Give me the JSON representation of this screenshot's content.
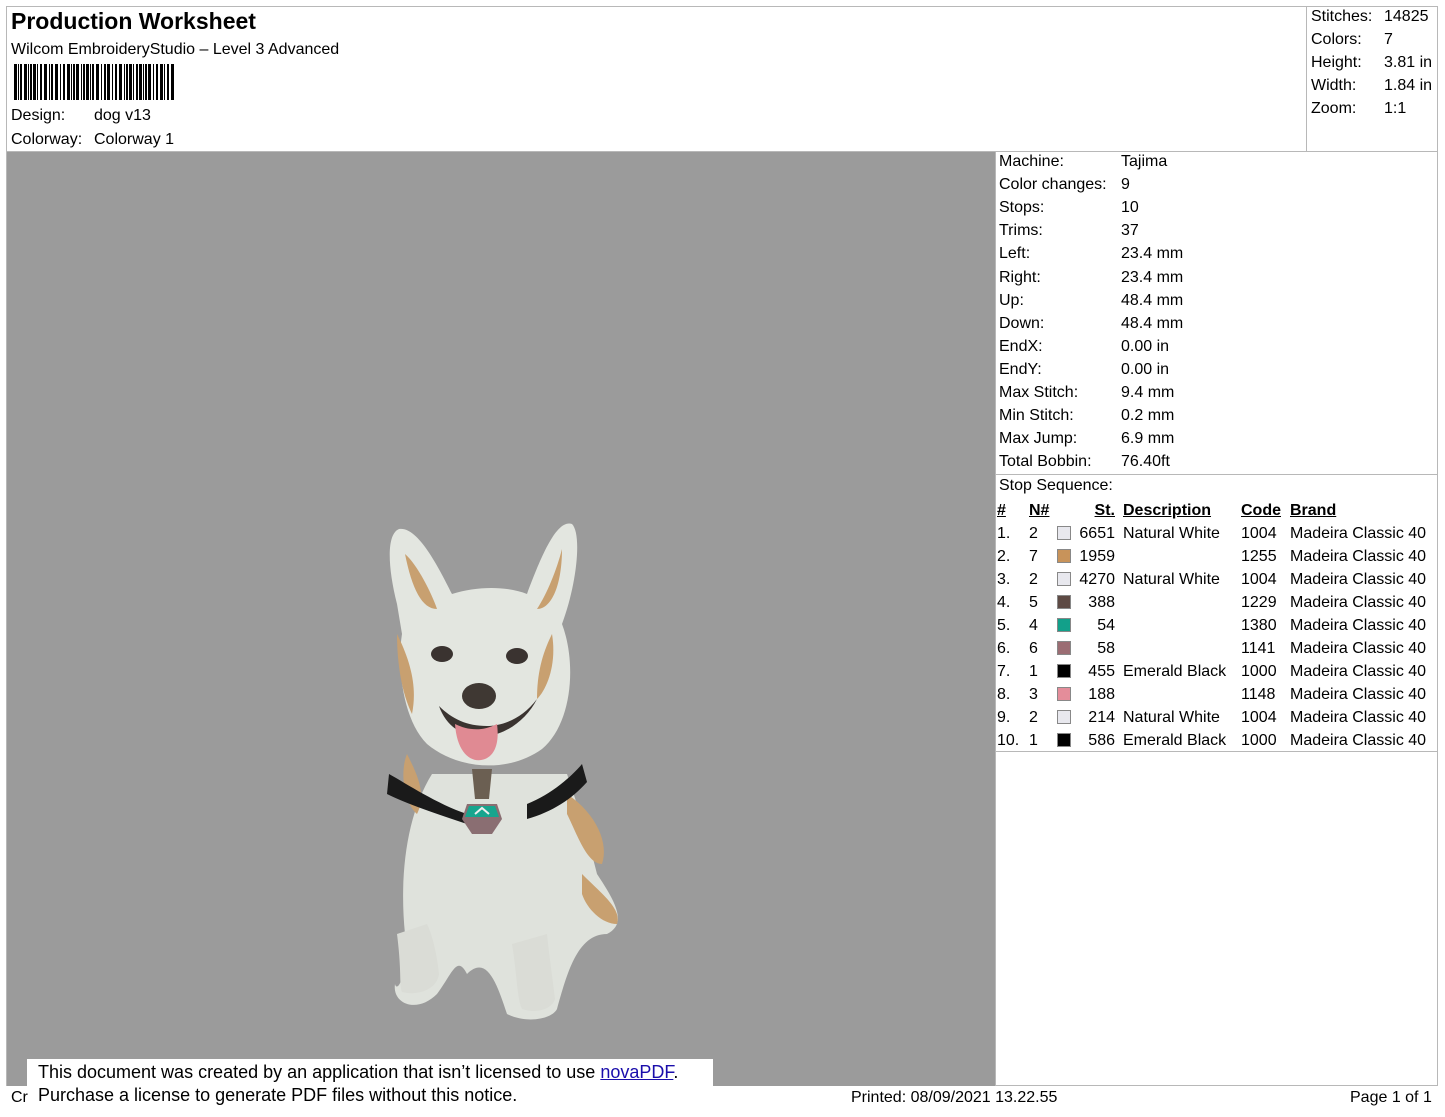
{
  "header": {
    "title": "Production Worksheet",
    "subtitle": "Wilcom EmbroideryStudio – Level 3 Advanced",
    "design_label": "Design:",
    "design_value": "dog v13",
    "colorway_label": "Colorway:",
    "colorway_value": "Colorway 1"
  },
  "summary": [
    {
      "label": "Stitches:",
      "value": "14825"
    },
    {
      "label": "Colors:",
      "value": "7"
    },
    {
      "label": "Height:",
      "value": "3.81 in"
    },
    {
      "label": "Width:",
      "value": "1.84 in"
    },
    {
      "label": "Zoom:",
      "value": "1:1"
    }
  ],
  "machine_info": [
    {
      "label": "Machine:",
      "value": "Tajima"
    },
    {
      "label": "Color changes:",
      "value": "9"
    },
    {
      "label": "Stops:",
      "value": "10"
    },
    {
      "label": "Trims:",
      "value": "37"
    },
    {
      "label": "Left:",
      "value": "23.4 mm"
    },
    {
      "label": "Right:",
      "value": "23.4 mm"
    },
    {
      "label": "Up:",
      "value": "48.4 mm"
    },
    {
      "label": "Down:",
      "value": "48.4 mm"
    },
    {
      "label": "EndX:",
      "value": "0.00 in"
    },
    {
      "label": "EndY:",
      "value": "0.00 in"
    },
    {
      "label": "Max Stitch:",
      "value": "9.4 mm"
    },
    {
      "label": "Min Stitch:",
      "value": "0.2 mm"
    },
    {
      "label": "Max Jump:",
      "value": "6.9 mm"
    },
    {
      "label": "Total Bobbin:",
      "value": "76.40ft"
    }
  ],
  "stop_sequence": {
    "title": "Stop Sequence:",
    "headers": {
      "idx": "#",
      "n": "N#",
      "st": "St.",
      "desc": "Description",
      "code": "Code",
      "brand": "Brand"
    },
    "rows": [
      {
        "idx": "1.",
        "n": "2",
        "color": "#e8e8ee",
        "st": "6651",
        "desc": "Natural White",
        "code": "1004",
        "brand": "Madeira Classic 40"
      },
      {
        "idx": "2.",
        "n": "7",
        "color": "#c8935a",
        "st": "1959",
        "desc": "",
        "code": "1255",
        "brand": "Madeira Classic 40"
      },
      {
        "idx": "3.",
        "n": "2",
        "color": "#e8e8ee",
        "st": "4270",
        "desc": "Natural White",
        "code": "1004",
        "brand": "Madeira Classic 40"
      },
      {
        "idx": "4.",
        "n": "5",
        "color": "#5e4a44",
        "st": "388",
        "desc": "",
        "code": "1229",
        "brand": "Madeira Classic 40"
      },
      {
        "idx": "5.",
        "n": "4",
        "color": "#12a08a",
        "st": "54",
        "desc": "",
        "code": "1380",
        "brand": "Madeira Classic 40"
      },
      {
        "idx": "6.",
        "n": "6",
        "color": "#9b6d73",
        "st": "58",
        "desc": "",
        "code": "1141",
        "brand": "Madeira Classic 40"
      },
      {
        "idx": "7.",
        "n": "1",
        "color": "#000000",
        "st": "455",
        "desc": "Emerald Black",
        "code": "1000",
        "brand": "Madeira Classic 40"
      },
      {
        "idx": "8.",
        "n": "3",
        "color": "#e48d9a",
        "st": "188",
        "desc": "",
        "code": "1148",
        "brand": "Madeira Classic 40"
      },
      {
        "idx": "9.",
        "n": "2",
        "color": "#e8e8ee",
        "st": "214",
        "desc": "Natural White",
        "code": "1004",
        "brand": "Madeira Classic 40"
      },
      {
        "idx": "10.",
        "n": "1",
        "color": "#000000",
        "st": "586",
        "desc": "Emerald Black",
        "code": "1000",
        "brand": "Madeira Classic 40"
      }
    ]
  },
  "notice": {
    "line1_pre": "This document was created by an application that isn’t licensed to use ",
    "link": "novaPDF",
    "line1_post": ".",
    "line2": "Purchase a license to generate PDF files without this notice."
  },
  "footer": {
    "left_fragment": "Cr",
    "printed": "Printed: 08/09/2021 13.22.55",
    "page": "Page 1 of 1"
  },
  "colors": {
    "preview_bg": "#9b9b9b",
    "border": "#b8b8b8",
    "link": "#1a0dab"
  }
}
